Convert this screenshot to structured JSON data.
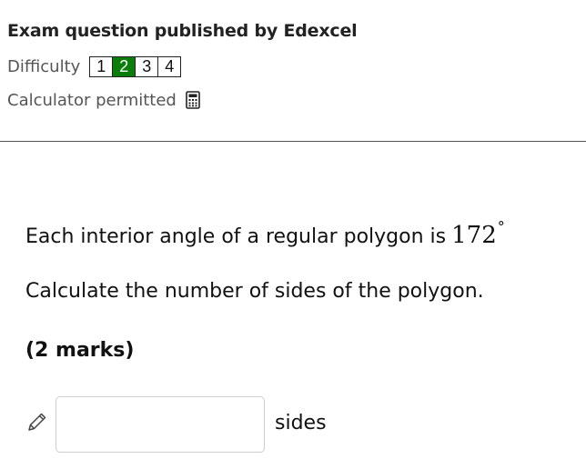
{
  "header": {
    "exam_title": "Exam question published by Edexcel",
    "difficulty_label": "Difficulty",
    "difficulty_levels": [
      "1",
      "2",
      "3",
      "4"
    ],
    "difficulty_selected": "2",
    "calculator_label": "Calculator permitted",
    "calculator_icon": "calculator-icon"
  },
  "question": {
    "text": "Each interior angle of a regular polygon is",
    "angle_value": "172",
    "angle_unit": "°",
    "instruction": "Calculate the number of sides of the polygon.",
    "marks": "(2 marks)"
  },
  "answer": {
    "value": "",
    "unit": "sides",
    "edit_icon": "pencil-icon"
  },
  "colors": {
    "difficulty_active": "#0a7d0a",
    "divider": "#555555",
    "input_border": "#cfcfcf"
  }
}
